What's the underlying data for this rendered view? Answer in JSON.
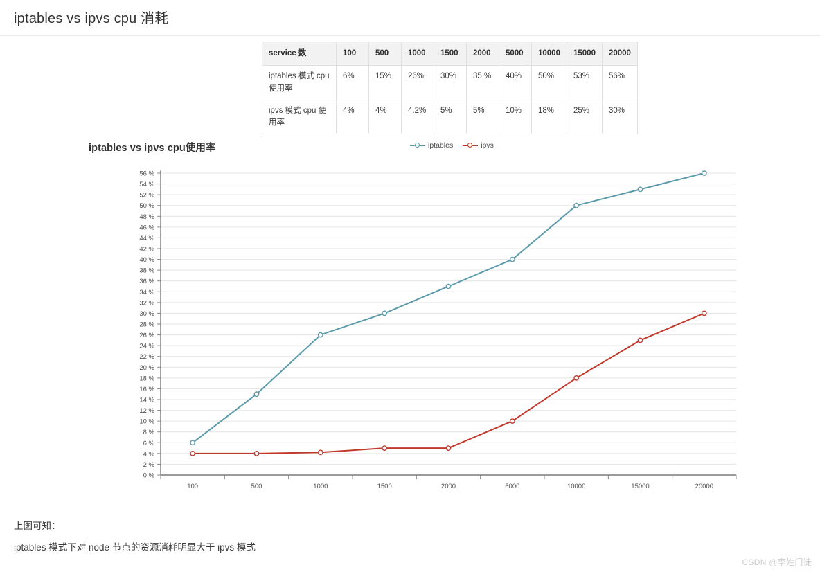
{
  "page": {
    "title": "iptables vs ipvs cpu 消耗",
    "watermark": "CSDN @李姓门徒"
  },
  "table": {
    "headers": [
      "service 数",
      "100",
      "500",
      "1000",
      "1500",
      "2000",
      "5000",
      "10000",
      "15000",
      "20000"
    ],
    "rows": [
      {
        "label": "iptables 模式 cpu 使用率",
        "values": [
          "6%",
          "15%",
          "26%",
          "30%",
          "35 %",
          "40%",
          "50%",
          "53%",
          "56%"
        ]
      },
      {
        "label": "ipvs 模式 cpu 使用率",
        "values": [
          "4%",
          "4%",
          "4.2%",
          "5%",
          "5%",
          "10%",
          "18%",
          "25%",
          "30%"
        ]
      }
    ]
  },
  "chart_data": {
    "type": "line",
    "title": "iptables vs ipvs cpu使用率",
    "xlabel": "",
    "ylabel": "",
    "categories": [
      "100",
      "500",
      "1000",
      "1500",
      "2000",
      "5000",
      "10000",
      "15000",
      "20000"
    ],
    "series": [
      {
        "name": "iptables",
        "color": "#5b9aaa",
        "values": [
          6,
          15,
          26,
          30,
          35,
          40,
          50,
          53,
          56
        ]
      },
      {
        "name": "ipvs",
        "color": "#c0392b",
        "values": [
          4,
          4,
          4.2,
          5,
          5,
          10,
          18,
          25,
          30
        ]
      }
    ],
    "ylim": [
      0,
      56
    ],
    "ytick_step": 2,
    "ytick_labels": [
      "0 %",
      "2 %",
      "4 %",
      "6 %",
      "8 %",
      "10 %",
      "12 %",
      "14 %",
      "16 %",
      "18 %",
      "20 %",
      "22 %",
      "24 %",
      "26 %",
      "28 %",
      "30 %",
      "32 %",
      "34 %",
      "36 %",
      "38 %",
      "40 %",
      "42 %",
      "44 %",
      "46 %",
      "48 %",
      "50 %",
      "52 %",
      "54 %",
      "56 %"
    ],
    "grid": true,
    "legend_position": "top-right",
    "marker": "circle-hollow"
  },
  "footer": {
    "line1": "上图可知：",
    "line2": "iptables 模式下对 node 节点的资源消耗明显大于 ipvs 模式"
  }
}
